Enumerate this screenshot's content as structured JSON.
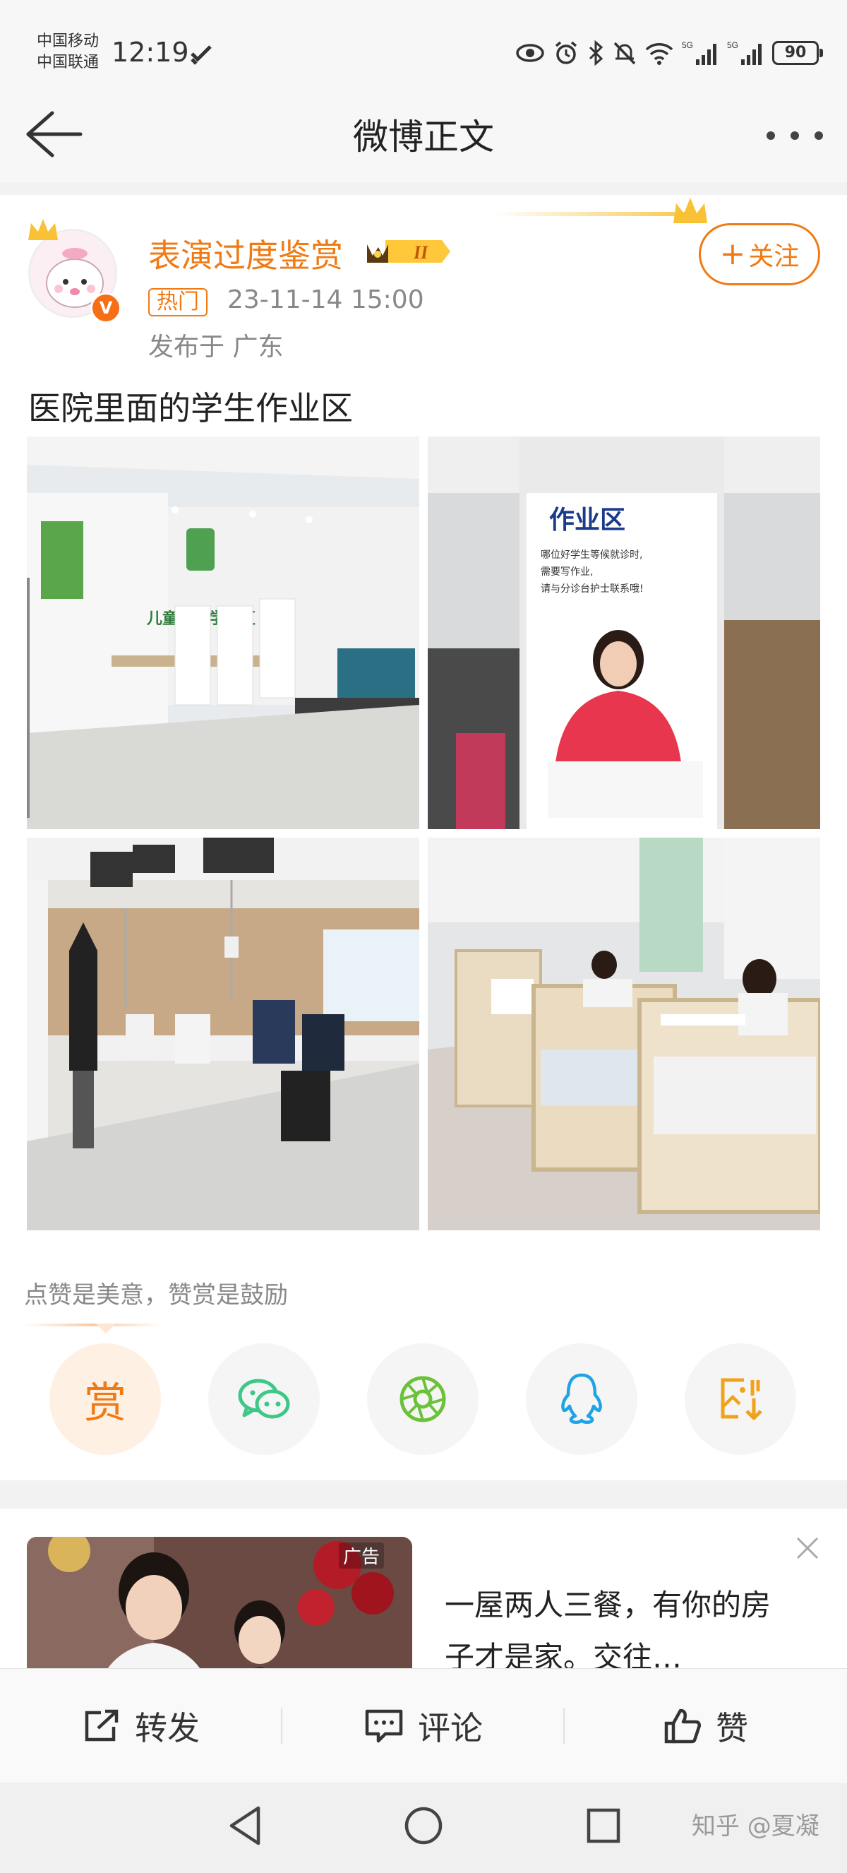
{
  "status_bar": {
    "carrier_1": "中国移动",
    "carrier_2": "中国联通",
    "time": "12:19",
    "signal_label_1": "5G",
    "signal_label_2": "5G",
    "battery": "90",
    "icons": [
      "eye-icon",
      "alarm-icon",
      "bluetooth-icon",
      "mute-icon",
      "wifi-icon",
      "signal-icon",
      "signal-icon",
      "battery-icon"
    ]
  },
  "nav": {
    "title": "微博正文",
    "back_icon": "back-arrow-icon",
    "more_icon": "more-dots-icon"
  },
  "post": {
    "username": "表演过度鉴赏",
    "vip_level": "II",
    "verified_badge": "V",
    "hot_tag": "热门",
    "time": "23-11-14 15:00",
    "location": "发布于 广东",
    "follow_label": "关注",
    "follow_plus": "+",
    "text": "医院里面的学生作业区",
    "photos": [
      {
        "sign": "儿童输液学习区"
      },
      {
        "poster_title": "作业区",
        "poster_line_1": "哪位好学生等候就诊时,",
        "poster_line_2": "需要写作业,",
        "poster_line_3": "请与分诊台护士联系哦!"
      },
      {},
      {}
    ]
  },
  "encourage": {
    "text": "点赞是美意，赞赏是鼓励",
    "reward_label": "赏",
    "share_icons": [
      "wechat-icon",
      "moments-icon",
      "qq-icon",
      "save-image-icon"
    ]
  },
  "ad": {
    "tag": "广告",
    "text": "一屋两人三餐，有你的房子才是家。交往…",
    "close_icon": "close-icon"
  },
  "actions": {
    "repost": "转发",
    "comment": "评论",
    "like": "赞"
  },
  "system_nav": {
    "watermark": "知乎 @夏凝"
  },
  "colors": {
    "accent": "#f07a14",
    "wechat": "#3ec786",
    "moments": "#6bc23a",
    "qq": "#1fa3e6",
    "save": "#f2a21a"
  }
}
